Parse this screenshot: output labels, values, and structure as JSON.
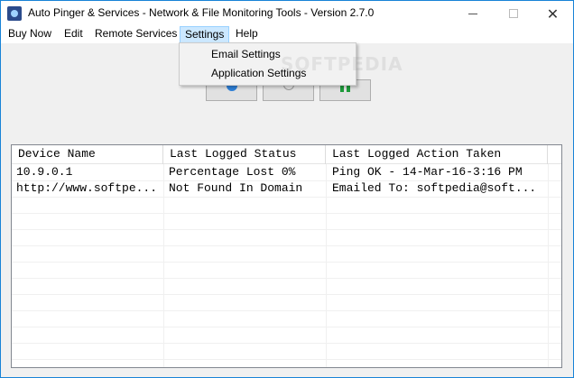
{
  "window": {
    "title": "Auto Pinger & Services - Network & File Monitoring Tools - Version 2.7.0",
    "minimize_glyph": "",
    "close_glyph": "✕"
  },
  "menubar": {
    "items": [
      {
        "label": "Buy Now"
      },
      {
        "label": "Edit"
      },
      {
        "label": "Remote Services"
      },
      {
        "label": "Settings"
      },
      {
        "label": "Help"
      }
    ]
  },
  "settings_menu": {
    "items": [
      {
        "label": "Email Settings"
      },
      {
        "label": "Application Settings"
      }
    ]
  },
  "toolbar": {
    "buttons": [
      {
        "icon": "refresh-icon"
      },
      {
        "icon": "stop-icon"
      },
      {
        "icon": "pause-icon"
      }
    ]
  },
  "listview": {
    "columns": [
      "Device Name",
      "Last Logged Status",
      "Last Logged Action Taken"
    ],
    "rows": [
      [
        "10.9.0.1",
        "Percentage Lost 0%",
        "Ping OK - 14-Mar-16-3:16 PM"
      ],
      [
        "http://www.softpe...",
        "Not Found In Domain",
        "Emailed To: softpedia@soft..."
      ]
    ]
  },
  "watermark": {
    "text": "SOFTPEDIA"
  }
}
